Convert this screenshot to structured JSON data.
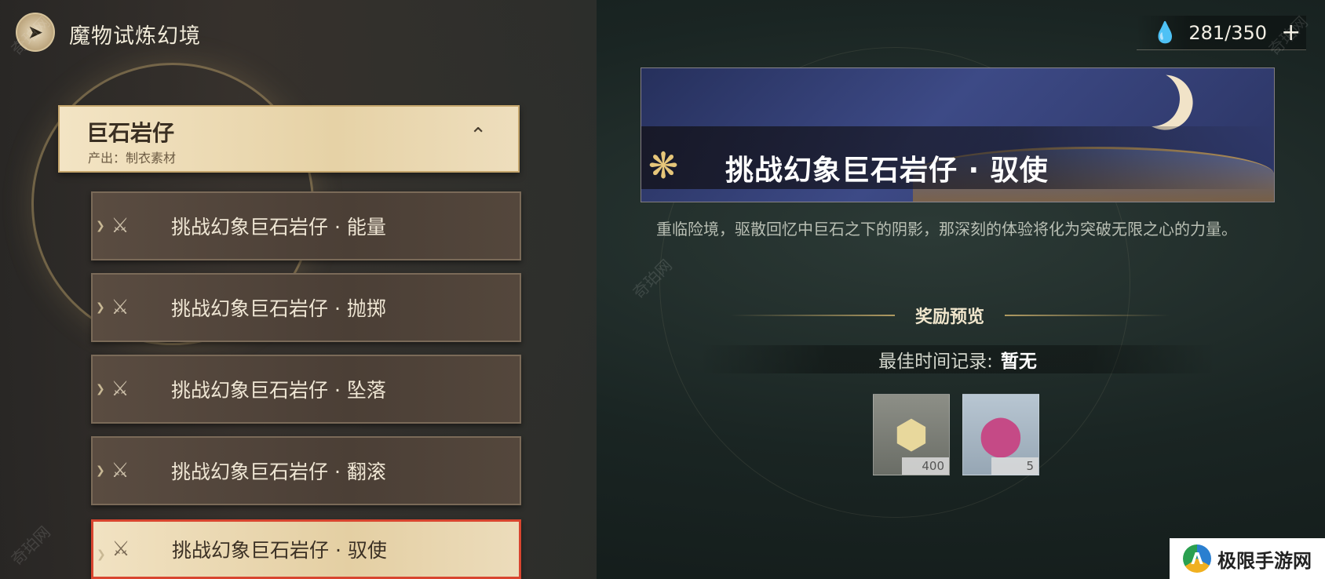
{
  "header": {
    "back_icon": "back-arrow-icon",
    "title": "魔物试炼幻境",
    "stamina": {
      "icon": "water-drop-icon",
      "value": "281/350",
      "plus_label": "+"
    }
  },
  "category": {
    "name": "巨石岩仔",
    "subtitle": "产出：制衣素材",
    "toggle_icon": "chevron-up-icon"
  },
  "stages": [
    {
      "label": "挑战幻象巨石岩仔 · 能量",
      "selected": false
    },
    {
      "label": "挑战幻象巨石岩仔 · 抛掷",
      "selected": false
    },
    {
      "label": "挑战幻象巨石岩仔 · 坠落",
      "selected": false
    },
    {
      "label": "挑战幻象巨石岩仔 · 翻滚",
      "selected": false
    },
    {
      "label": "挑战幻象巨石岩仔 · 驭使",
      "selected": true
    }
  ],
  "detail": {
    "banner_title": "挑战幻象巨石岩仔 · 驭使",
    "description": "重临险境，驱散回忆中巨石之下的阴影，那深刻的体验将化为突破无限之心的力量。",
    "reward_title": "奖励预览",
    "best_time_label": "最佳时间记录:",
    "best_time_value": "暂无",
    "rewards": [
      {
        "icon": "gold-emblem-icon",
        "quantity": "400"
      },
      {
        "icon": "crystal-orb-icon",
        "quantity": "5"
      }
    ]
  },
  "watermark": {
    "badge_text": "极限手游网",
    "faint_text": "奇珀网"
  },
  "colors": {
    "selected_border": "#d8452f",
    "card_light": "#f1e2c2",
    "card_dark": "#4b3f36"
  }
}
